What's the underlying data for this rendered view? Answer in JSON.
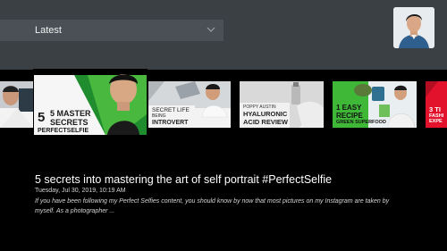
{
  "header": {
    "dropdown_label": "Latest"
  },
  "thumbnails": [
    {
      "lines": [
        "5 MASTER",
        "SECRETS",
        "PERFECTSELFIE"
      ]
    },
    {
      "lines": [
        "SECRET LIFE",
        "BEING",
        "INTROVERT"
      ]
    },
    {
      "lines": [
        "POPPY AUSTIN",
        "HYALURONIC",
        "ACID REVIEW"
      ]
    },
    {
      "lines": [
        "1 EASY",
        "RECIPE",
        "GREEN SUPERFOOD"
      ]
    },
    {
      "lines": [
        "3 TI",
        "FASHI",
        "EXPE"
      ]
    }
  ],
  "detail": {
    "title": "5 secrets into mastering the art of self portrait #PerfectSelfie",
    "date": "Tuesday, Jul 30, 2019, 10:19 AM",
    "description": "If you have been following my Perfect Selfies content, you should know by now that most pictures on my Instagram are taken by myself. As a photographer ..."
  },
  "colors": {
    "header_bg": "#3b4045",
    "dropdown_bg": "#4a5056",
    "green_accent": "#3fb837",
    "red_accent": "#e2122c"
  }
}
